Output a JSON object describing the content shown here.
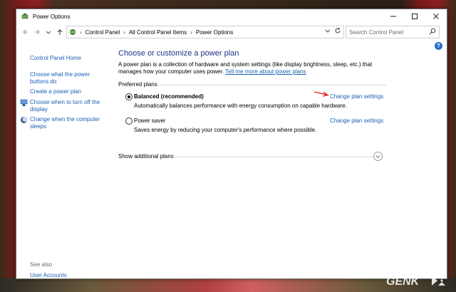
{
  "window": {
    "title": "Power Options"
  },
  "address": {
    "crumbs": [
      "Control Panel",
      "All Control Panel Items",
      "Power Options"
    ]
  },
  "search": {
    "placeholder": "Search Control Panel"
  },
  "sidebar": {
    "home": "Control Panel Home",
    "items": [
      {
        "label": "Choose what the power buttons do",
        "icon": null
      },
      {
        "label": "Create a power plan",
        "icon": null
      },
      {
        "label": "Choose when to turn off the display",
        "icon": "monitor-icon"
      },
      {
        "label": "Change when the computer sleeps",
        "icon": "moon-icon"
      }
    ],
    "see_also": "See also",
    "user_accounts": "User Accounts"
  },
  "main": {
    "title": "Choose or customize a power plan",
    "intro": "A power plan is a collection of hardware and system settings (like display brightness, sleep, etc.) that manages how your computer uses power.",
    "intro_link": "Tell me more about power plans",
    "preferred_label": "Preferred plans",
    "plans": [
      {
        "name": "Balanced (recommended)",
        "desc": "Automatically balances performance with energy consumption on capable hardware.",
        "link": "Change plan settings",
        "selected": true
      },
      {
        "name": "Power saver",
        "desc": "Saves energy by reducing your computer's performance where possible.",
        "link": "Change plan settings",
        "selected": false
      }
    ],
    "show_additional": "Show additional plans"
  },
  "colors": {
    "link": "#1a5fb4",
    "title": "#1e3287",
    "annotation_arrow": "#e02020"
  },
  "watermark": "GENK"
}
